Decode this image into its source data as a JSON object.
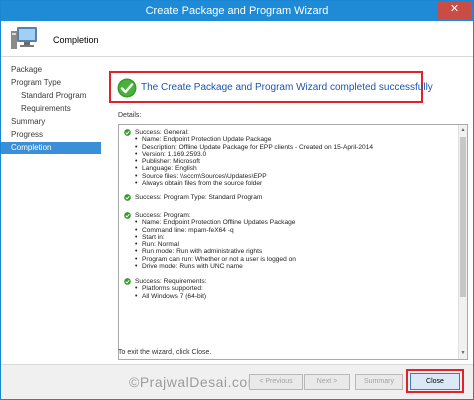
{
  "window": {
    "title": "Create Package and Program Wizard",
    "close_glyph": "✕"
  },
  "header": {
    "title": "Completion",
    "icon": "computer-icon"
  },
  "sidebar": {
    "items": [
      {
        "label": "Package"
      },
      {
        "label": "Program Type"
      },
      {
        "label": "Standard Program"
      },
      {
        "label": "Requirements"
      },
      {
        "label": "Summary"
      },
      {
        "label": "Progress"
      },
      {
        "label": "Completion"
      }
    ]
  },
  "banner": {
    "message": "The Create Package and Program Wizard completed successfully",
    "icon": "success-check-icon"
  },
  "details": {
    "label": "Details:",
    "blocks": [
      {
        "heading": "Success: General:",
        "items": [
          "Name: Endpoint Protection Update Package",
          "Description: Offline Update Package for EPP clients - Created on 15-April-2014",
          "Version: 1.169.2593.0",
          "Publisher: Microsoft",
          "Language: English",
          "Source files: \\\\sccm\\Sources\\Updates\\EPP",
          "Always obtain files from the source folder"
        ]
      },
      {
        "heading": "Success: Program Type: Standard Program",
        "items": []
      },
      {
        "heading": "Success: Program:",
        "items": [
          "Name: Endpoint Protection Offline Updates Package",
          "Command line: mpam-feX64 -q",
          "Start in:",
          "Run: Normal",
          "Run mode: Run with administrative rights",
          "Program can run: Whether or not a user is logged on",
          "Drive mode: Runs with UNC name"
        ]
      },
      {
        "heading": "Success: Requirements:",
        "items": [
          "Platforms supported:",
          "All Windows 7 (64-bit)"
        ]
      }
    ]
  },
  "exit_text": "To exit the wizard, click Close.",
  "watermark": "©PrajwalDesai.com",
  "buttons": {
    "previous": "< Previous",
    "next": "Next >",
    "summary": "Summary",
    "close": "Close"
  },
  "colors": {
    "titlebar": "#1f8ad6",
    "active_nav": "#3b8ed8",
    "highlight_outline": "#e4202a",
    "banner_text": "#1c55b0",
    "success_green": "#3a9a2e"
  }
}
